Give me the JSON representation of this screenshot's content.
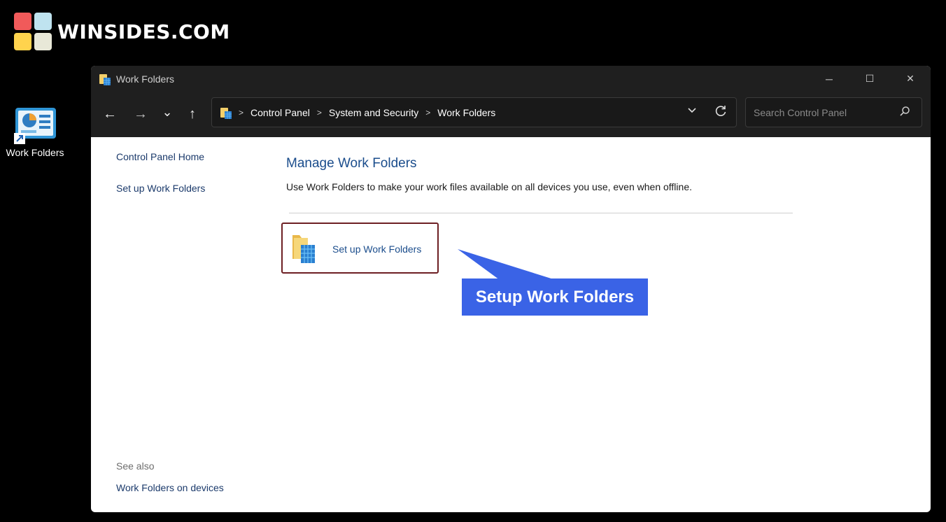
{
  "brand": {
    "name": "WINSIDES.COM"
  },
  "desktop": {
    "icon_label": "Work Folders"
  },
  "window": {
    "title": "Work Folders",
    "controls": {
      "minimize": "─",
      "maximize": "☐",
      "close": "✕"
    }
  },
  "nav": {
    "back": "←",
    "forward": "→",
    "recent": "⌄",
    "up": "↑",
    "breadcrumb": [
      "Control Panel",
      "System and Security",
      "Work Folders"
    ],
    "search_placeholder": "Search Control Panel"
  },
  "sidebar": {
    "links": [
      "Control Panel Home",
      "Set up Work Folders"
    ],
    "see_also_label": "See also",
    "see_also_links": [
      "Work Folders on devices"
    ]
  },
  "main": {
    "heading": "Manage Work Folders",
    "description": "Use Work Folders to make your work files available on all devices you use, even when offline.",
    "task_label": "Set up Work Folders"
  },
  "callout": {
    "text": "Setup Work Folders",
    "color": "#3a63e6"
  },
  "colors": {
    "highlight_border": "#6d1f23",
    "link": "#1b4d8c",
    "titlebar": "#1f1f1f"
  }
}
